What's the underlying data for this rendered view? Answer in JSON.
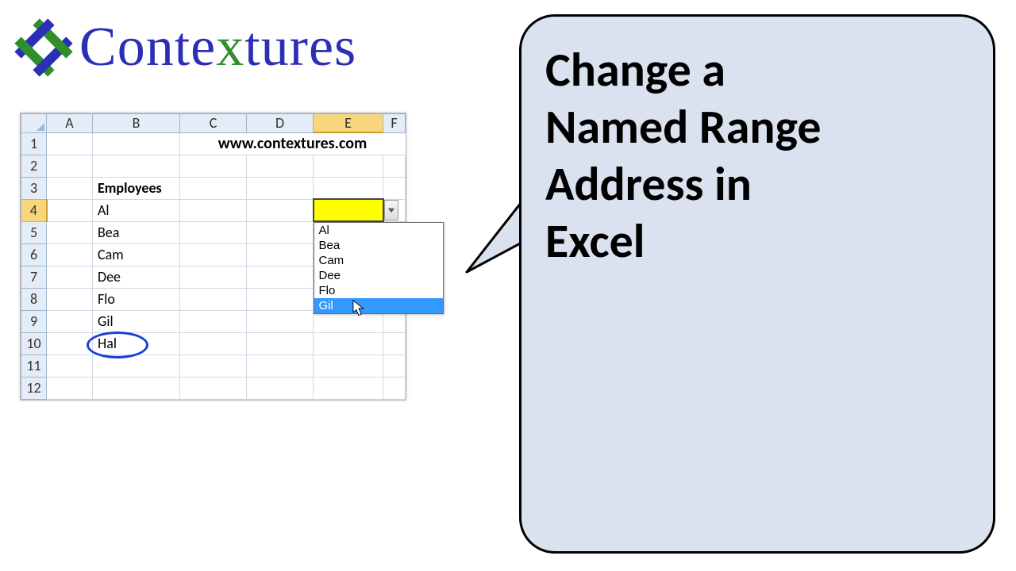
{
  "logo": {
    "text_before_x": "Conte",
    "x": "x",
    "text_after_x": "tures"
  },
  "sheet": {
    "columns": [
      "A",
      "B",
      "C",
      "D",
      "E",
      "F"
    ],
    "rows": [
      "1",
      "2",
      "3",
      "4",
      "5",
      "6",
      "7",
      "8",
      "9",
      "10",
      "11",
      "12"
    ],
    "url": "www.contextures.com",
    "header_label": "Employees",
    "employees": [
      "Al",
      "Bea",
      "Cam",
      "Dee",
      "Flo",
      "Gil",
      "Hal"
    ],
    "circled_employee": "Hal",
    "selected_cell_value": "",
    "dropdown": {
      "items": [
        "Al",
        "Bea",
        "Cam",
        "Dee",
        "Flo",
        "Gil"
      ],
      "highlighted": "Gil"
    },
    "col_widths": {
      "A": 58,
      "B": 110,
      "C": 84,
      "D": 84,
      "E": 88,
      "F": 28
    },
    "active_col": "E",
    "active_row": "4"
  },
  "bubble": {
    "line1": "Change a",
    "line2": "Named Range",
    "line3": "Address in",
    "line4": "Excel"
  }
}
